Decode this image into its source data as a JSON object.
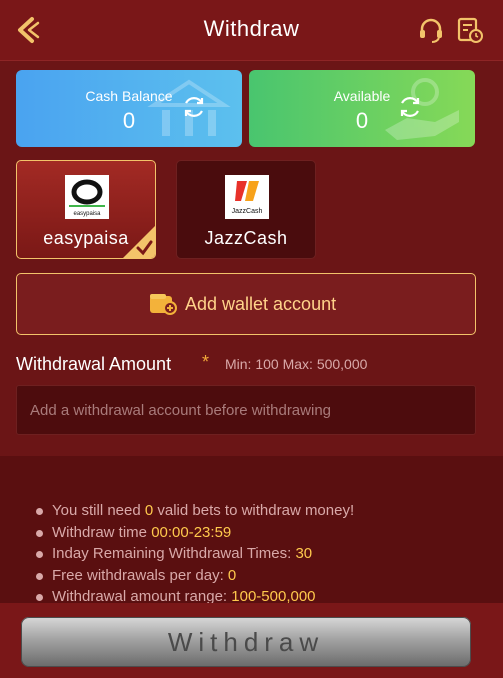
{
  "header": {
    "title": "Withdraw",
    "back_icon": "back-arrow-icon",
    "support_icon": "headset-icon",
    "records_icon": "records-icon"
  },
  "balances": {
    "cash": {
      "label": "Cash Balance",
      "value": "0"
    },
    "available": {
      "label": "Available",
      "value": "0"
    }
  },
  "methods": [
    {
      "label": "easypaisa",
      "logo_text": "easypaisa",
      "selected": true
    },
    {
      "label": "JazzCash",
      "logo_text": "JazzCash",
      "selected": false
    }
  ],
  "add_wallet": {
    "label": "Add wallet account"
  },
  "amount": {
    "title": "Withdrawal Amount",
    "required_mark": "*",
    "limits": "Min: 100 Max: 500,000",
    "placeholder": "Add a withdrawal account before withdrawing"
  },
  "tips": {
    "t1_prefix": "You still need ",
    "t1_value": "0",
    "t1_suffix": " valid bets to withdraw money!",
    "t2_prefix": "Withdraw time ",
    "t2_value": "00:00-23:59",
    "t3_prefix": "Inday Remaining Withdrawal Times: ",
    "t3_value": "30",
    "t4_prefix": "Free withdrawals per day: ",
    "t4_value": "0",
    "t5_prefix": "Withdrawal amount range: ",
    "t5_value": "100-500,000"
  },
  "withdraw_button": {
    "label": "Withdraw"
  },
  "colors": {
    "background": "#5a0f10",
    "header": "#7a1718",
    "accent_gold": "#f3c36a",
    "highlight": "#ffc94d",
    "cash_card": "#4aa3f0",
    "available_card": "#49c56f"
  }
}
